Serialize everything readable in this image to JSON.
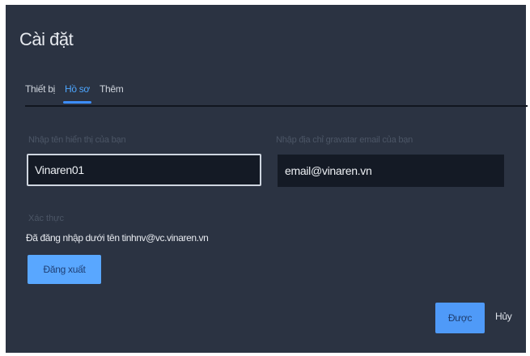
{
  "dialog": {
    "title": "Cài đặt",
    "tabs": [
      {
        "label": "Thiết bị",
        "active": false
      },
      {
        "label": "Hồ sơ",
        "active": true
      },
      {
        "label": "Thêm",
        "active": false
      }
    ],
    "display_name": {
      "label": "Nhập tên hiển thị của bạn",
      "value": "Vinaren01"
    },
    "gravatar": {
      "label": "Nhập địa chỉ gravatar email của bạn",
      "value": "email@vinaren.vn"
    },
    "auth": {
      "section_label": "Xác thực",
      "logged_in_text": "Đã đăng nhập dưới tên tinhnv@vc.vinaren.vn",
      "logout_label": "Đăng xuất"
    },
    "footer": {
      "ok_label": "Được",
      "cancel_label": "Hủy"
    }
  },
  "colors": {
    "background": "#2b3342",
    "input_background": "#141a25",
    "accent": "#4da6ff",
    "button": "#59a7ff"
  }
}
